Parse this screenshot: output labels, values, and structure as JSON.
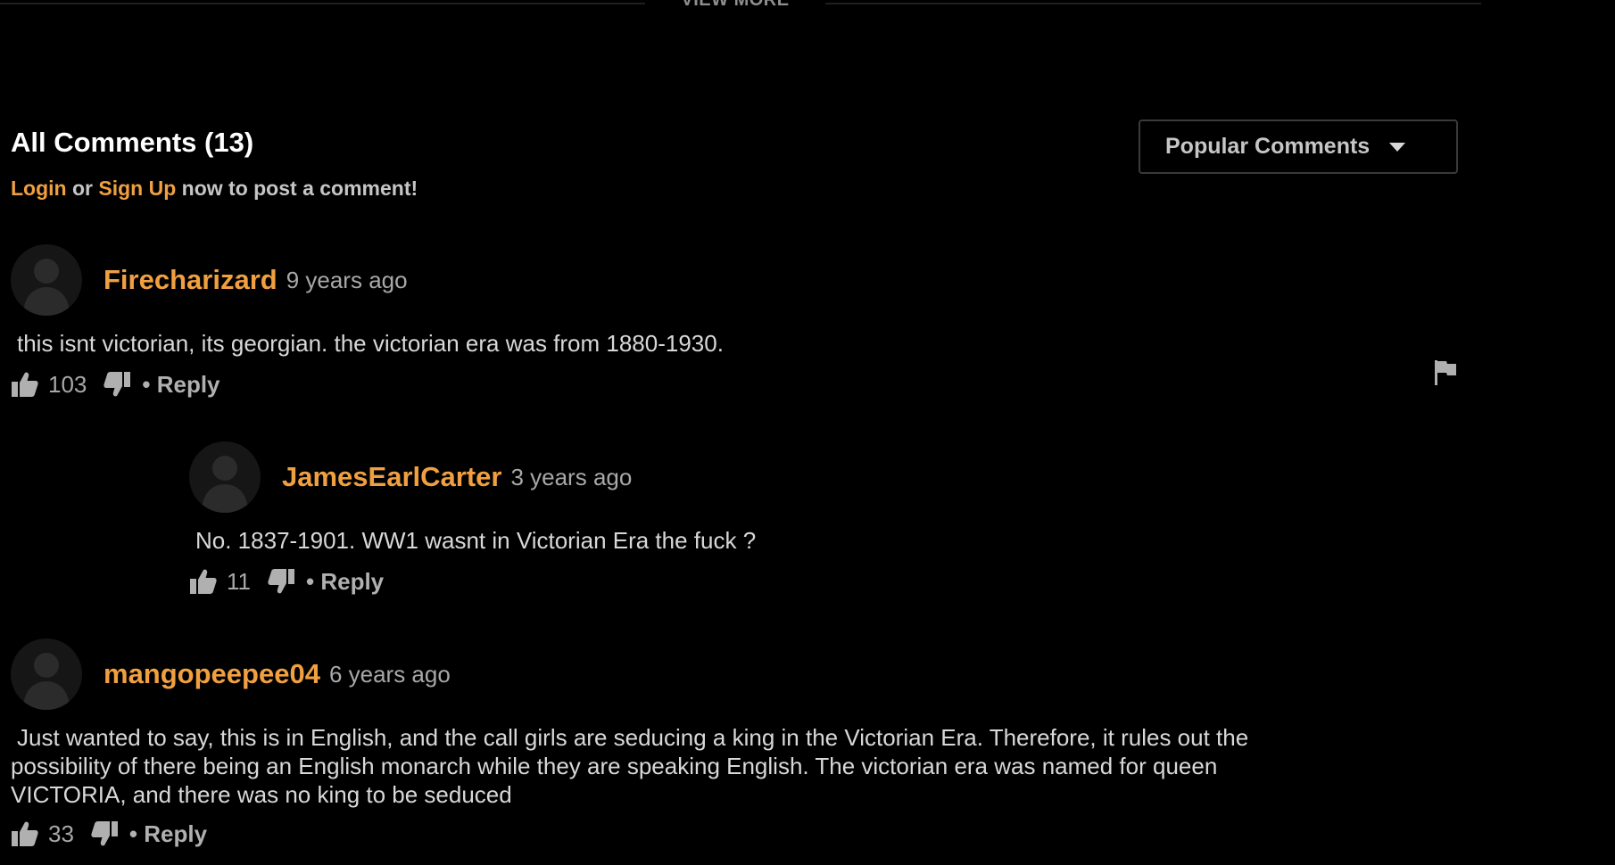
{
  "view_more": {
    "label": "VIEW MORE"
  },
  "comments_section": {
    "title": "All Comments (13)",
    "auth": {
      "login": "Login",
      "or": "or",
      "signup": "Sign Up",
      "suffix": "now to post a comment!"
    },
    "sort": {
      "selected": "Popular Comments",
      "icon": "chevron-down-icon"
    }
  },
  "comments": [
    {
      "username": "Firecharizard",
      "time": "9 years ago",
      "text": "this isnt victorian, its georgian. the victorian era was from 1880-1930.",
      "likes": "103",
      "reply_label": "• Reply"
    },
    {
      "username": "JamesEarlCarter",
      "time": "3 years ago",
      "text": "No. 1837-1901. WW1 wasnt in Victorian Era the fuck ?",
      "likes": "11",
      "reply_label": "• Reply"
    },
    {
      "username": "mangopeepee04",
      "time": "6 years ago",
      "text": "Just wanted to say, this is in English, and the call girls are seducing a king in the Victorian Era. Therefore, it rules out the possibility of there being an English monarch while they are speaking English. The victorian era was named for queen VICTORIA, and there was no king to be seduced",
      "likes": "33",
      "reply_label": "• Reply"
    }
  ],
  "icons": {
    "like": "thumbs-up-icon",
    "dislike": "thumbs-down-icon",
    "flag": "flag-icon",
    "avatar": "default-avatar-icon"
  },
  "colors": {
    "background": "#000000",
    "accent": "#f0a040",
    "text": "#d8d8d8",
    "muted": "#a8a8a8"
  }
}
